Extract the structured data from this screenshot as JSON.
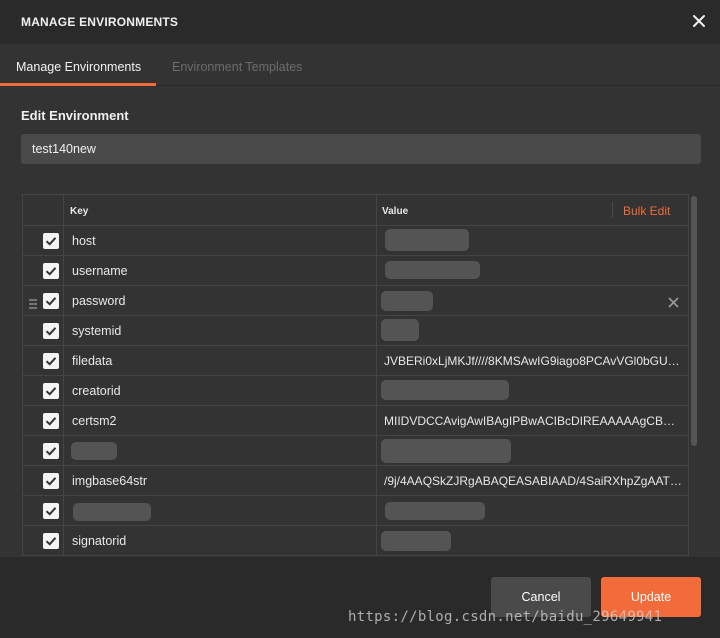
{
  "window": {
    "title": "MANAGE ENVIRONMENTS",
    "close_icon": "close-icon"
  },
  "tabs": [
    {
      "label": "Manage Environments",
      "active": true
    },
    {
      "label": "Environment Templates",
      "active": false
    }
  ],
  "edit": {
    "section_title": "Edit Environment",
    "name_value": "test140new"
  },
  "table": {
    "key_header": "Key",
    "value_header": "Value",
    "bulk_edit": "Bulk Edit",
    "rows": [
      {
        "key": "host",
        "value": ""
      },
      {
        "key": "username",
        "value": ""
      },
      {
        "key": "password",
        "value": ""
      },
      {
        "key": "systemid",
        "value": ""
      },
      {
        "key": "filedata",
        "value": "JVBERi0xLjMKJf////8KMSAwIG9iago8PCAvVGl0bGUg..."
      },
      {
        "key": "creatorid",
        "value": ""
      },
      {
        "key": "certsm2",
        "value": "MIIDVDCCAvigAwIBAgIPBwACIBcDIREAAAAAgCBQM..."
      },
      {
        "key": "",
        "value": ""
      },
      {
        "key": "imgbase64str",
        "value": "/9j/4AAQSkZJRgABAQEASABIAAD/4SaiRXhpZgAATU..."
      },
      {
        "key": "",
        "value": ""
      },
      {
        "key": "signatorid",
        "value": ""
      }
    ]
  },
  "footer": {
    "cancel_label": "Cancel",
    "update_label": "Update"
  },
  "watermark": "https://blog.csdn.net/baidu_29649941",
  "colors": {
    "accent": "#f26b3a",
    "background": "#333333",
    "header": "#2a2a2a"
  }
}
